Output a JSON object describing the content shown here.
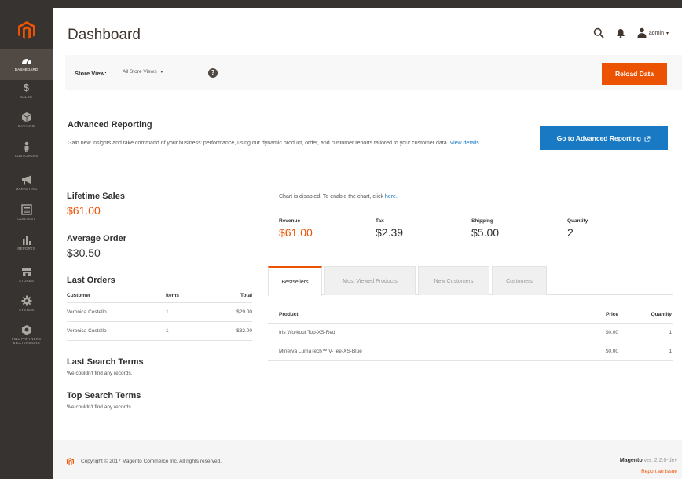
{
  "colors": {
    "sidebar_bg": "#373330",
    "sidebar_active": "#514943",
    "accent_orange": "#eb5202",
    "link_blue": "#1979c3",
    "store_bar_bg": "#f8f8f8",
    "footer_bg": "#f5f5f5"
  },
  "sidebar": {
    "logo_icon": "magento-logo-icon",
    "items": [
      {
        "label": "DASHBOARD",
        "icon": "dashboard-icon",
        "active": true
      },
      {
        "label": "SALES",
        "icon": "dollar-icon"
      },
      {
        "label": "CATALOG",
        "icon": "cube-icon"
      },
      {
        "label": "CUSTOMERS",
        "icon": "person-icon"
      },
      {
        "label": "MARKETING",
        "icon": "megaphone-icon"
      },
      {
        "label": "CONTENT",
        "icon": "layout-icon"
      },
      {
        "label": "REPORTS",
        "icon": "bar-chart-icon"
      },
      {
        "label": "STORES",
        "icon": "store-icon"
      },
      {
        "label": "SYSTEM",
        "icon": "gear-icon"
      },
      {
        "label": "FIND PARTNERS",
        "label2": "& EXTENSIONS",
        "icon": "partners-icon"
      }
    ]
  },
  "header": {
    "title": "Dashboard",
    "admin_label": "admin",
    "caret": "▾"
  },
  "store_bar": {
    "label": "Store View:",
    "selected": "All Store Views",
    "caret": "▾",
    "help": "?",
    "reload_label": "Reload Data"
  },
  "advanced": {
    "title": "Advanced Reporting",
    "text": "Gain new insights and take command of your business' performance, using our dynamic product, order, and customer reports tailored to your customer data.",
    "link": "View details",
    "button_label": "Go to Advanced Reporting"
  },
  "stats": {
    "lifetime_label": "Lifetime Sales",
    "lifetime_value": "$61.00",
    "average_label": "Average Order",
    "average_value": "$30.50"
  },
  "last_orders": {
    "title": "Last Orders",
    "headers": [
      "Customer",
      "Items",
      "Total"
    ],
    "rows": [
      [
        "Veronica Costello",
        "1",
        "$29.00"
      ],
      [
        "Veronica Costello",
        "1",
        "$32.00"
      ]
    ]
  },
  "last_search": {
    "title": "Last Search Terms",
    "empty": "We couldn't find any records."
  },
  "top_search": {
    "title": "Top Search Terms",
    "empty": "We couldn't find any records."
  },
  "chart": {
    "message": "Chart is disabled. To enable the chart, click",
    "link": "here."
  },
  "totals": [
    {
      "label": "Revenue",
      "value": "$61.00"
    },
    {
      "label": "Tax",
      "value": "$2.39"
    },
    {
      "label": "Shipping",
      "value": "$5.00"
    },
    {
      "label": "Quantity",
      "value": "2"
    }
  ],
  "tabs": [
    {
      "label": "Bestsellers",
      "active": true
    },
    {
      "label": "Most Viewed Products"
    },
    {
      "label": "New Customers"
    },
    {
      "label": "Customers"
    }
  ],
  "products": {
    "headers": [
      "Product",
      "Price",
      "Quantity"
    ],
    "rows": [
      [
        "Iris Workout Top-XS-Red",
        "$0.00",
        "1"
      ],
      [
        "Minerva LumaTech™ V-Tee-XS-Blue",
        "$0.00",
        "1"
      ]
    ]
  },
  "footer": {
    "copyright": "Copyright © 2017 Magento Commerce Inc. All rights reserved.",
    "brand": "Magento",
    "version": "ver. 2.2.0-dev",
    "report": "Report an Issue"
  }
}
